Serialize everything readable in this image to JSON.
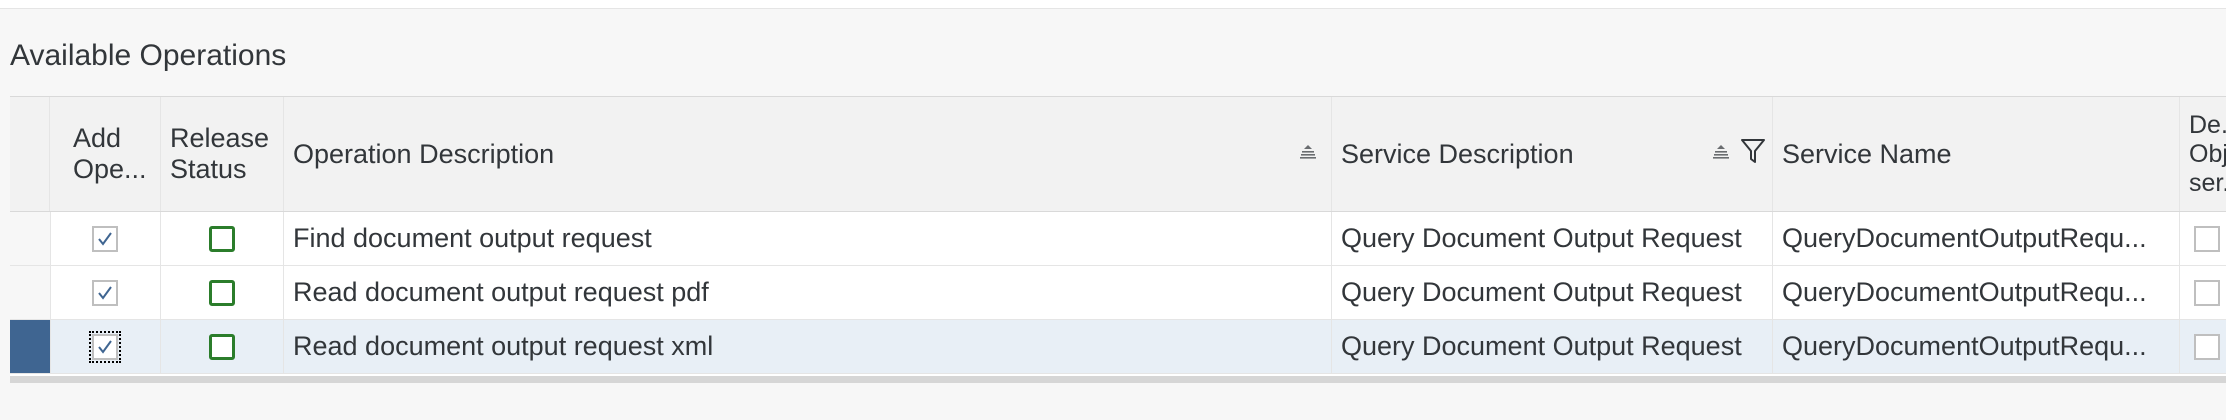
{
  "section": {
    "title": "Available Operations"
  },
  "table": {
    "headers": {
      "add_operation": "Add Ope...",
      "add_operation_line1": "Add",
      "add_operation_line2": "Ope...",
      "release_status_line1": "Release",
      "release_status_line2": "Status",
      "operation_description": "Operation Description",
      "service_description": "Service Description",
      "service_name": "Service Name",
      "deprecated_line1": "De...",
      "deprecated_line2": "Obj...",
      "deprecated_line3": "ser..."
    },
    "rows": [
      {
        "add_checked": true,
        "operation_description": "Find document output request",
        "service_description": "Query Document Output Request",
        "service_name": "QueryDocumentOutputRequ...",
        "selected": false
      },
      {
        "add_checked": true,
        "operation_description": "Read document output request pdf",
        "service_description": "Query Document Output Request",
        "service_name": "QueryDocumentOutputRequ...",
        "selected": false
      },
      {
        "add_checked": true,
        "operation_description": "Read document output request xml",
        "service_description": "Query Document Output Request",
        "service_name": "QueryDocumentOutputRequ...",
        "selected": true
      }
    ]
  },
  "colors": {
    "selection_accent": "#3f6591",
    "status_green": "#2b7d2b",
    "header_bg": "#f2f2f2",
    "selected_row_bg": "#e8eff6"
  },
  "icons": {
    "sort": "sort-icon",
    "filter": "filter-icon",
    "checkmark": "checkmark-icon"
  }
}
